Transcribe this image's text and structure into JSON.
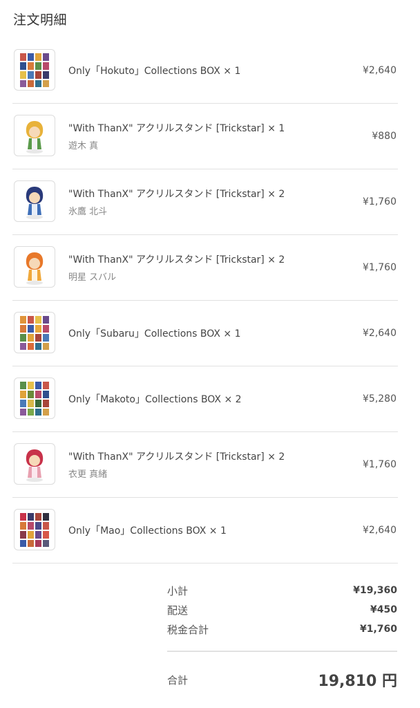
{
  "header": {
    "title": "注文明細"
  },
  "items": [
    {
      "name": "Only「Hokuto」Collections BOX × 1",
      "sub": "",
      "price": "¥2,640",
      "thumb": "box-cards"
    },
    {
      "name": "\"With ThanX\" アクリルスタンド [Trickstar] × 1",
      "sub": "遊木 真",
      "price": "¥880",
      "thumb": "acrylic-stand-yellow"
    },
    {
      "name": "\"With ThanX\" アクリルスタンド [Trickstar] × 2",
      "sub": "氷鷹 北斗",
      "price": "¥1,760",
      "thumb": "acrylic-stand-blue"
    },
    {
      "name": "\"With ThanX\" アクリルスタンド [Trickstar] × 2",
      "sub": "明星 スバル",
      "price": "¥1,760",
      "thumb": "acrylic-stand-orange"
    },
    {
      "name": "Only「Subaru」Collections BOX × 1",
      "sub": "",
      "price": "¥2,640",
      "thumb": "box-cards"
    },
    {
      "name": "Only「Makoto」Collections BOX × 2",
      "sub": "",
      "price": "¥5,280",
      "thumb": "box-cards"
    },
    {
      "name": "\"With ThanX\" アクリルスタンド [Trickstar] × 2",
      "sub": "衣更 真緒",
      "price": "¥1,760",
      "thumb": "acrylic-stand-red"
    },
    {
      "name": "Only「Mao」Collections BOX × 1",
      "sub": "",
      "price": "¥2,640",
      "thumb": "box-cards"
    }
  ],
  "summary": {
    "subtotal_label": "小計",
    "subtotal_value": "¥19,360",
    "shipping_label": "配送",
    "shipping_value": "¥450",
    "tax_label": "税金合計",
    "tax_value": "¥1,760",
    "total_label": "合計",
    "total_value": "19,810 円"
  },
  "colors": {
    "divider": "#e1e1e1",
    "text": "#444444",
    "muted": "#888888"
  }
}
